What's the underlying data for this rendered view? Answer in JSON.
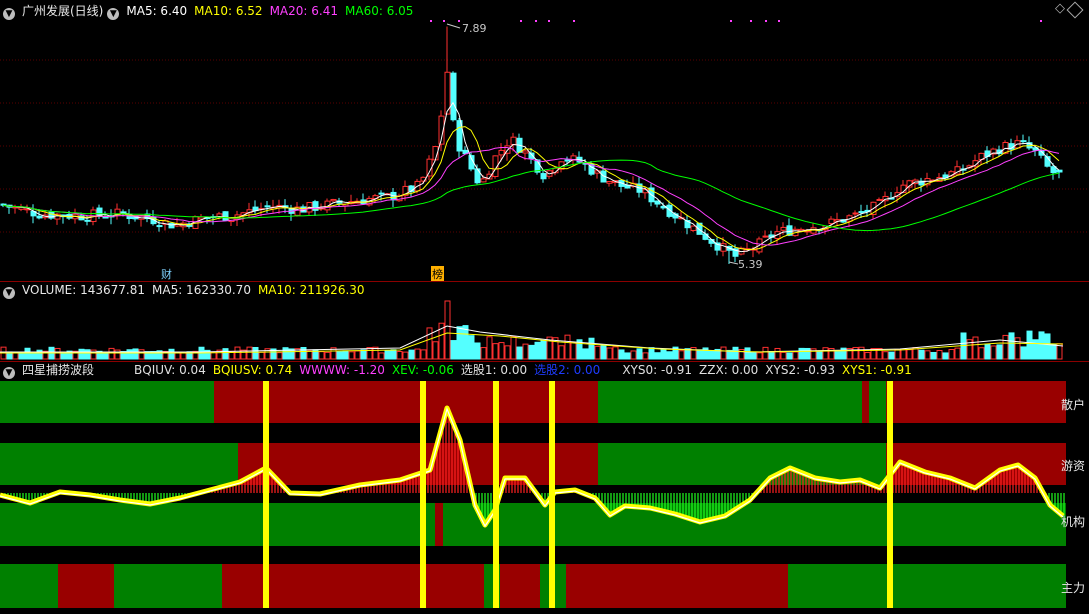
{
  "main": {
    "title": "广州发展(日线)",
    "ma5": "MA5: 6.40",
    "ma10": "MA10: 6.52",
    "ma20": "MA20: 6.41",
    "ma60": "MA60: 6.05",
    "high_label": "7.89",
    "low_label": "5.39",
    "marker_cai": "财",
    "marker_bang": "榜",
    "colors": {
      "ma5": "#ffffff",
      "ma10": "#ffff00",
      "ma20": "#ff40ff",
      "ma60": "#00ff00",
      "up": "#ff3030",
      "down": "#54ffff"
    }
  },
  "volume": {
    "title": "VOLUME: 143677.81",
    "ma5": "MA5: 162330.70",
    "ma10": "MA10: 211926.30"
  },
  "indicator": {
    "title": "四星捕捞波段",
    "values": [
      {
        "text": "BQIUV: 0.04",
        "color": "#e0e0e0"
      },
      {
        "text": "BQIUSV: 0.74",
        "color": "#ffff00"
      },
      {
        "text": "WWWW: -1.20",
        "color": "#ff40ff"
      },
      {
        "text": "XEV: -0.06",
        "color": "#00ff00"
      },
      {
        "text": "选股1: 0.00",
        "color": "#e0e0e0"
      },
      {
        "text": "选股2: 0.00",
        "color": "#1e3cff"
      },
      {
        "text": "XYS0: -0.91",
        "color": "#e0e0e0"
      },
      {
        "text": "ZZX: 0.00",
        "color": "#e0e0e0"
      },
      {
        "text": "XYS2: -0.93",
        "color": "#e0e0e0"
      },
      {
        "text": "XYS1: -0.91",
        "color": "#ffff00"
      }
    ],
    "rows": {
      "sanhu": "散户",
      "youzi": "游资",
      "jigou": "机构",
      "zhuli": "主力"
    }
  }
}
